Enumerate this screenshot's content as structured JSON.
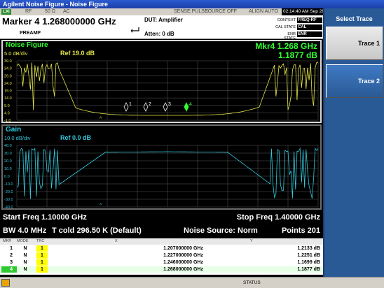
{
  "window": {
    "title": "Agilent Noise Figure - Noise Figure"
  },
  "status_row": {
    "lxi": "LXI",
    "rf": "RF",
    "impedance": "50 Ω",
    "ac": "AC",
    "sense": "SENSE:PULSE",
    "source": "SOURCE OFF",
    "align": "ALIGN AUTO",
    "time": "02:14:40 AM Sep 26, 2005"
  },
  "header": {
    "marker": "Marker 4 1.268000000 GHz",
    "preamp": "PREAMP",
    "dut": "DUT: Amplifier",
    "atten": "Atten: 0 dB",
    "context_label": "CONTEXT",
    "context_value": "FREQ-RF",
    "cal_state_label": "CAL STATE",
    "cal_state_value": "CAL",
    "enr_state_label": "ENR STATE",
    "enr_state_value": "ENR"
  },
  "noise_panel": {
    "title": "Noise Figure",
    "scale": "5.0 dB/div",
    "ref": "Ref 19.0 dB",
    "marker_freq": "Mkr4  1.268 GHz",
    "marker_val": "1.1877  dB",
    "y_labels": [
      "39.0",
      "34.0",
      "29.0",
      "24.0",
      "19.0",
      "14.0",
      "9.0",
      "4.0",
      "-1.0"
    ],
    "marker_labels": [
      "1",
      "2",
      "3",
      "4"
    ]
  },
  "gain_panel": {
    "title": "Gain",
    "scale": "10.0 dB/div",
    "ref": "Ref 0.0 dB",
    "y_labels": [
      "40.0",
      "30.0",
      "20.0",
      "10.0",
      "0.0",
      "-10.0",
      "-20.0",
      "-30.0",
      "-40.0"
    ]
  },
  "info": {
    "start_freq": "Start Freq 1.10000 GHz",
    "stop_freq": "Stop Freq 1.40000 GHz",
    "bw": "BW 4.0 MHz",
    "tcold": "T cold 296.50 K (Default)",
    "noise_source": "Noise Source: Norm",
    "points": "Points 201"
  },
  "marker_table": {
    "headers": {
      "mkr": "MKR",
      "mode": "MODE",
      "trc": "TRC",
      "x": "X",
      "y": "Y"
    },
    "rows": [
      {
        "no": "1",
        "mode": "N",
        "trc": "1",
        "x": "1.207000000 GHz",
        "y": "1.2133 dB"
      },
      {
        "no": "2",
        "mode": "N",
        "trc": "1",
        "x": "1.227000000 GHz",
        "y": "1.2251 dB"
      },
      {
        "no": "3",
        "mode": "N",
        "trc": "1",
        "x": "1.246000000 GHz",
        "y": "1.1699 dB"
      },
      {
        "no": "4",
        "mode": "N",
        "trc": "1",
        "x": "1.268000000 GHz",
        "y": "1.1877 dB"
      }
    ]
  },
  "sidebar": {
    "title": "Select Trace",
    "trace1": "Trace 1",
    "trace2": "Trace 2"
  },
  "bottom_bar": {
    "status": "STATUS"
  },
  "colors": {
    "noise_trace": "#e6e64a",
    "gain_trace": "#33c8dc",
    "marker": "#32ff32",
    "noise_title": "#32ff32",
    "gain_title": "#33c8dc",
    "grid": "#5a5a5a"
  }
}
